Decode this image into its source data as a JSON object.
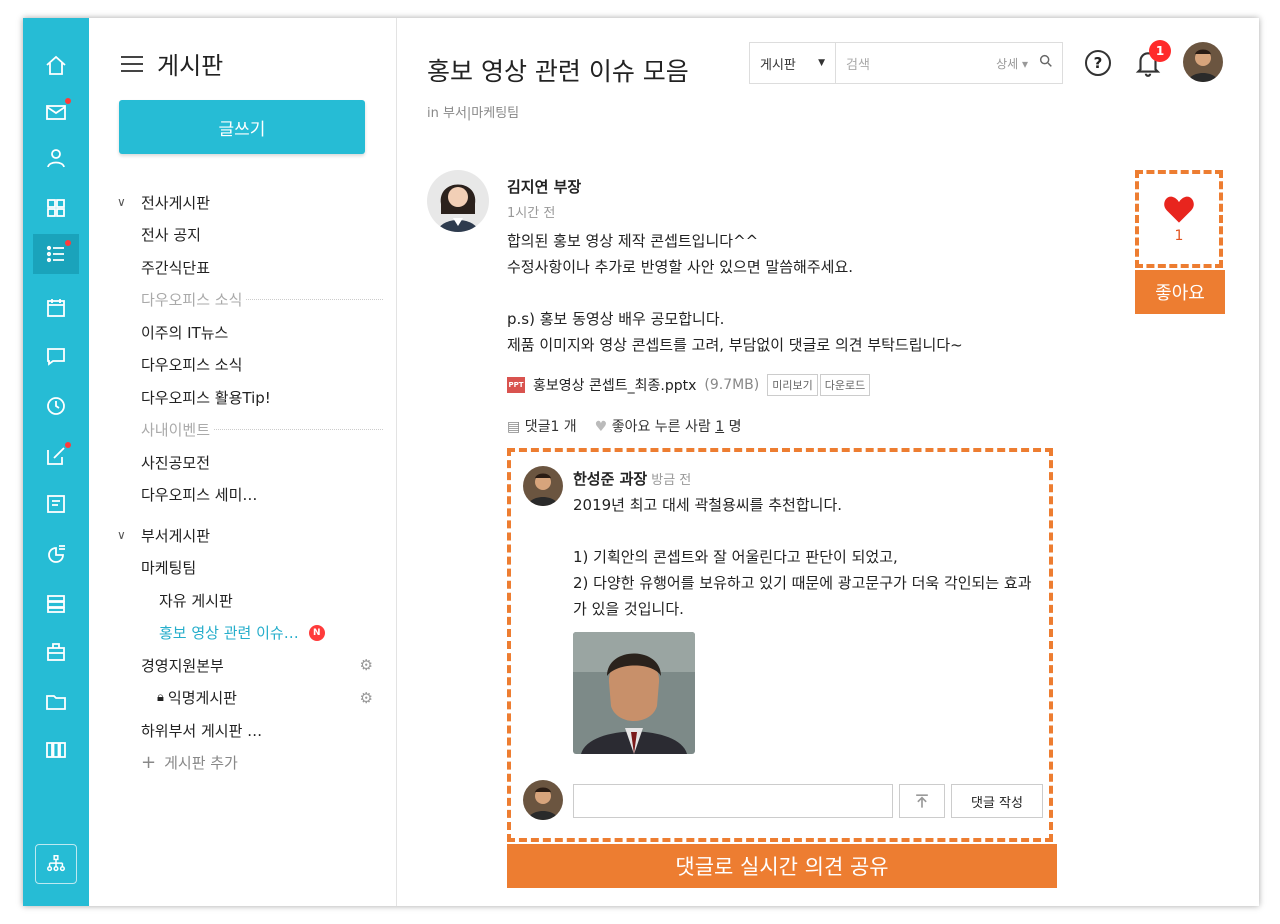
{
  "sidebar_board": {
    "title": "게시판",
    "write_label": "글쓰기",
    "groups": [
      {
        "label": "전사게시판"
      },
      {
        "label": "부서게시판"
      }
    ],
    "items": [
      "전사 공지",
      "주간식단표",
      "다우오피스 소식",
      "이주의 IT뉴스",
      "다우오피스 소식",
      "다우오피스 활용Tip!",
      "사내이벤트",
      "사진공모전",
      "다우오피스 세미…",
      "마케팅팀",
      "자유 게시판",
      "홍보 영상 관련 이슈…",
      "경영지원본부",
      "익명게시판",
      "하위부서 게시판 …"
    ],
    "new_badge": "N",
    "add_label": "게시판 추가"
  },
  "header": {
    "title": "홍보 영상 관련 이슈 모음",
    "location": "in 부서|마케팅팀",
    "search_scope": "게시판",
    "search_placeholder": "검색",
    "search_detail": "상세",
    "help": "?",
    "notification_count": "1"
  },
  "post": {
    "author": "김지연 부장",
    "time": "1시간 전",
    "lines": [
      "합의된 홍보 영상 제작 콘셉트입니다^^",
      "수정사항이나 추가로 반영할 사안 있으면 말씀해주세요.",
      "",
      "p.s) 홍보 동영상 배우 공모합니다.",
      "제품 이미지와 영상 콘셉트를 고려, 부담없이 댓글로 의견 부탁드립니다~"
    ],
    "attachment": {
      "icon_text": "PPT",
      "name": "홍보영상 콘셉트_최종.pptx",
      "size": "(9.7MB)",
      "preview": "미리보기",
      "download": "다운로드"
    },
    "comment_label": "댓글1 개",
    "like_label_prefix": "좋아요 누른 사람",
    "like_people": "1",
    "like_label_suffix": "명"
  },
  "like_box": {
    "count": "1",
    "button": "좋아요"
  },
  "comment": {
    "author": "한성준 과장",
    "time": "방금 전",
    "lines": [
      "2019년 최고 대세 곽철용씨를 추천합니다.",
      "",
      "1) 기획안의 콘셉트와 잘 어울린다고 판단이 되었고,",
      "2) 다양한 유행어를 보유하고 있기 때문에 광고문구가 더욱 각인되는 효과가 있을 것입니다."
    ],
    "submit": "댓글 작성"
  },
  "banner": "댓글로 실시간 의견 공유",
  "colors": {
    "accent": "#26bcd5",
    "orange": "#ed7d31",
    "badge": "#ff3b3b"
  }
}
